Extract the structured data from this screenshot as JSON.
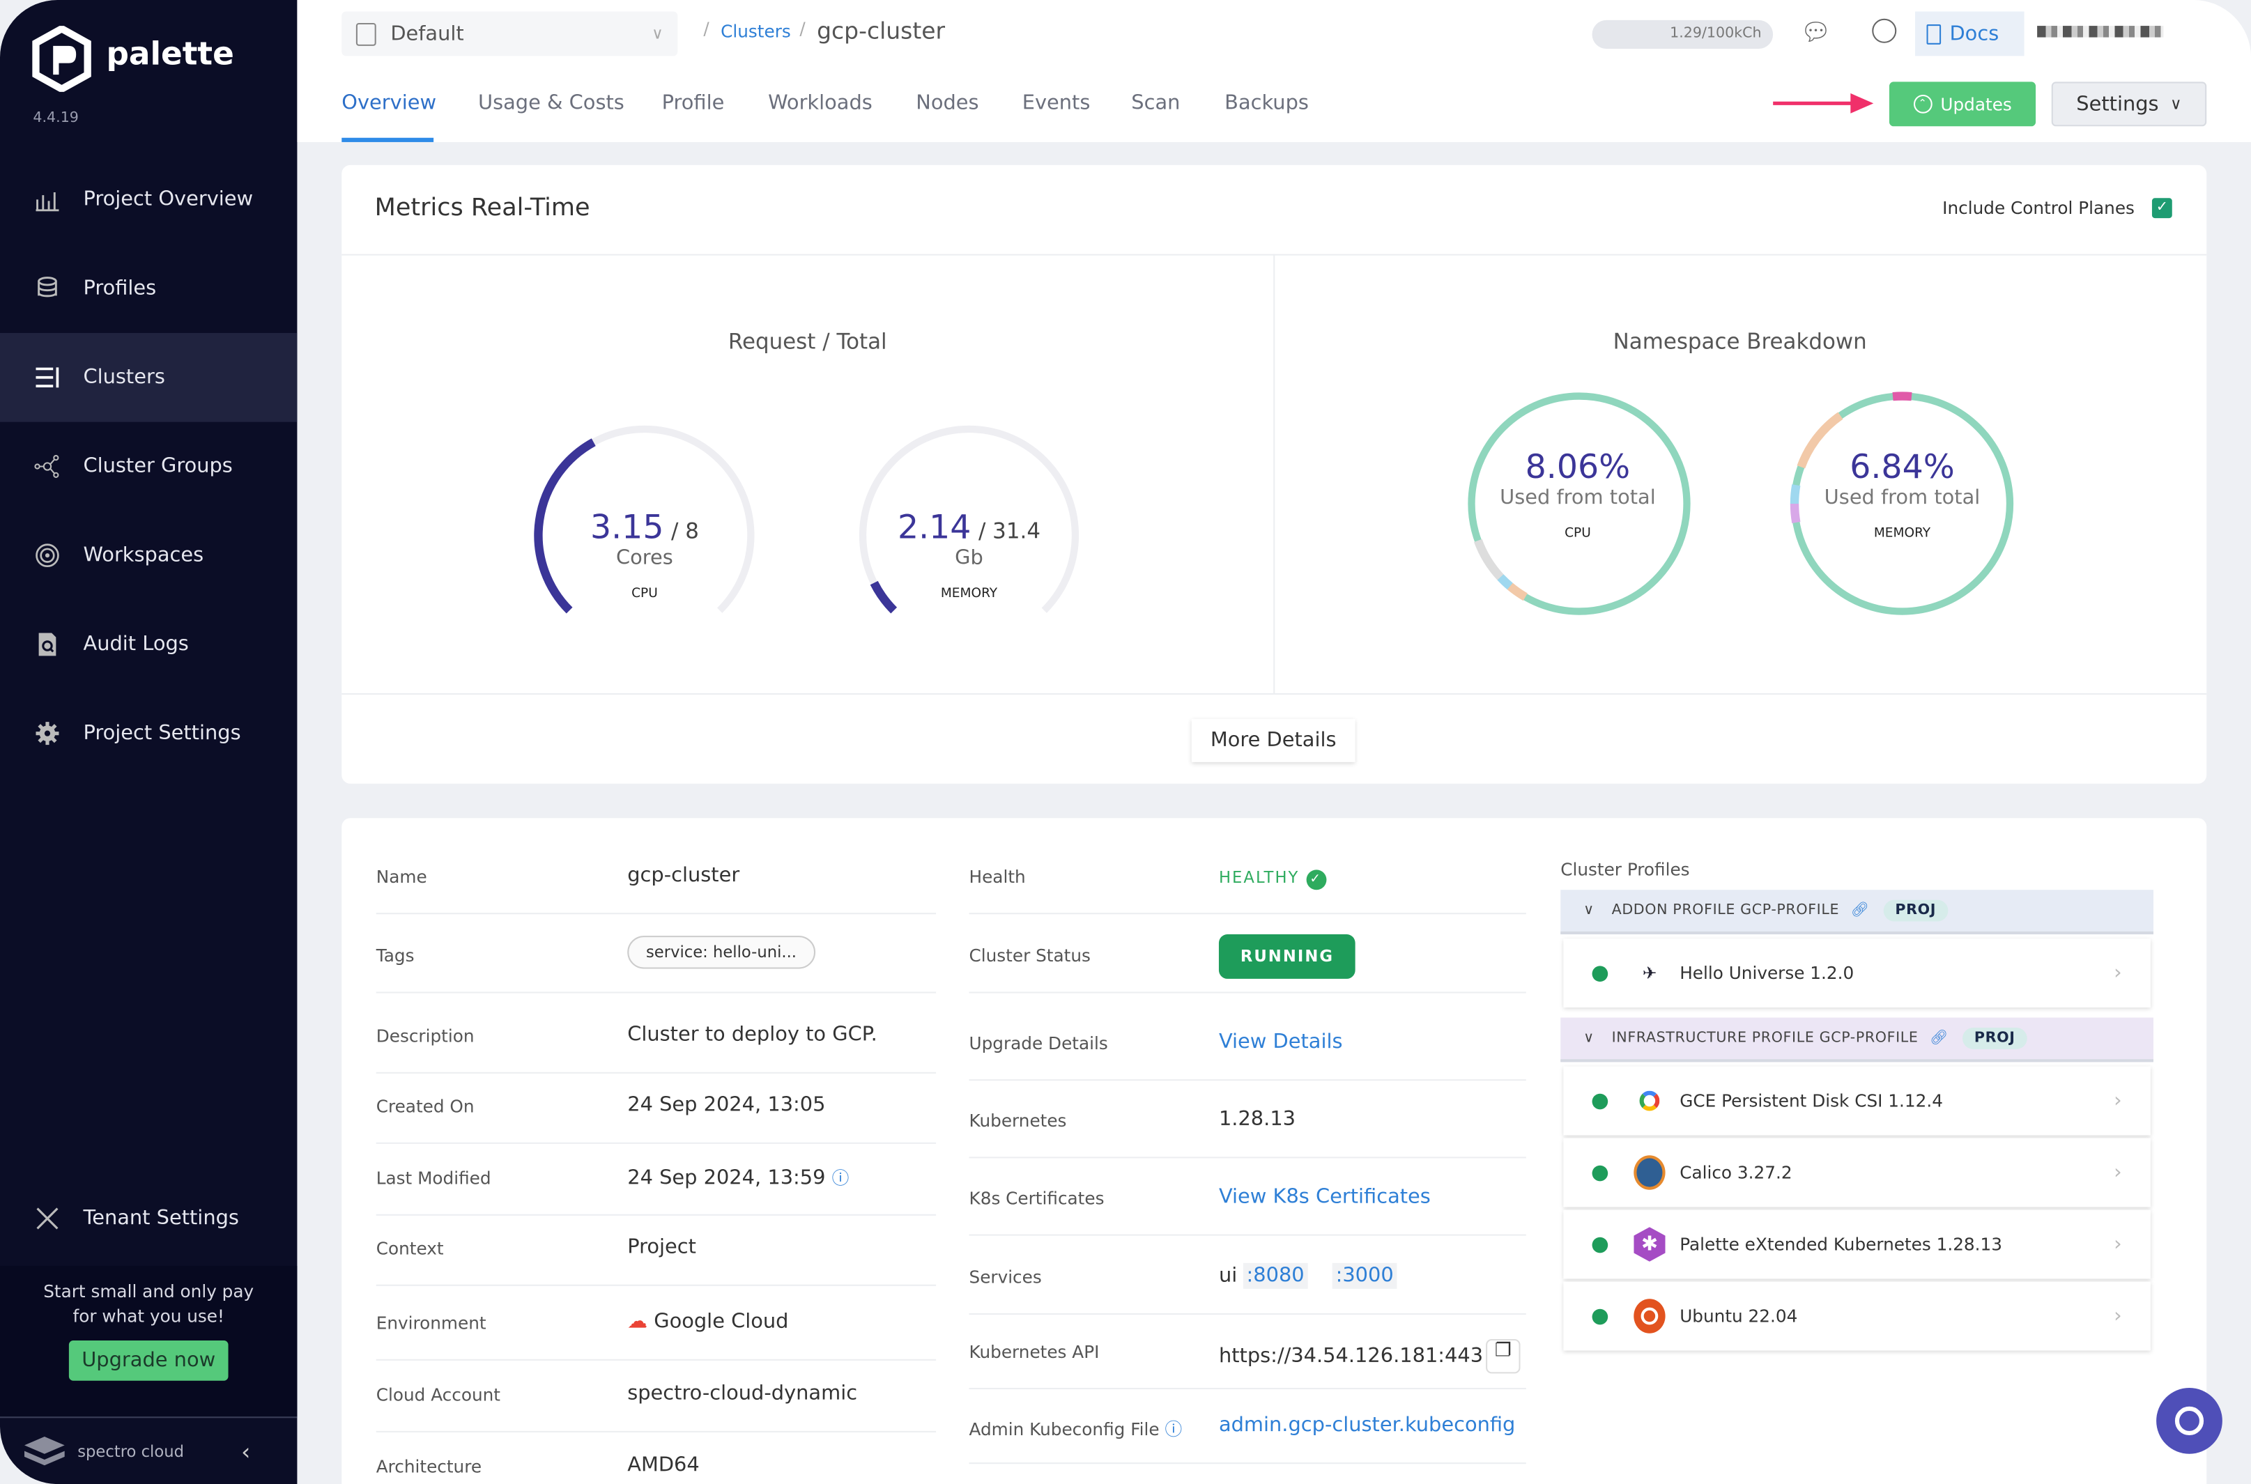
{
  "app": {
    "name": "palette",
    "version": "4.4.19"
  },
  "sidebar": {
    "items": [
      {
        "label": "Project Overview",
        "icon": "chart-icon"
      },
      {
        "label": "Profiles",
        "icon": "layers-icon"
      },
      {
        "label": "Clusters",
        "icon": "clusters-icon",
        "active": true
      },
      {
        "label": "Cluster Groups",
        "icon": "network-icon"
      },
      {
        "label": "Workspaces",
        "icon": "target-icon"
      },
      {
        "label": "Audit Logs",
        "icon": "audit-icon"
      },
      {
        "label": "Project Settings",
        "icon": "gear-icon"
      }
    ],
    "tenant_settings": "Tenant Settings",
    "promo_line1": "Start small and only pay",
    "promo_line2": "for what you use!",
    "upgrade": "Upgrade now",
    "brand": "spectro cloud"
  },
  "header": {
    "project": "Default",
    "breadcrumb": {
      "parent": "Clusters",
      "current": "gcp-cluster"
    },
    "usage": "1.29/100kCh",
    "docs": "Docs",
    "tabs": [
      "Overview",
      "Usage & Costs",
      "Profile",
      "Workloads",
      "Nodes",
      "Events",
      "Scan",
      "Backups"
    ],
    "active_tab": "Overview",
    "updates": "Updates",
    "settings": "Settings"
  },
  "metrics": {
    "title": "Metrics Real-Time",
    "include_control_planes": "Include Control Planes",
    "include_checked": true,
    "request_total": {
      "title": "Request / Total",
      "cpu": {
        "used": "3.15",
        "total": "/ 8",
        "unit": "Cores",
        "label": "CPU",
        "value": 3.15,
        "max": 8
      },
      "memory": {
        "used": "2.14",
        "total": "/ 31.4",
        "unit": "Gb",
        "label": "MEMORY",
        "value": 2.14,
        "max": 31.4
      }
    },
    "namespace": {
      "title": "Namespace Breakdown",
      "cpu": {
        "percent": "8.06%",
        "sub": "Used from total",
        "label": "CPU"
      },
      "memory": {
        "percent": "6.84%",
        "sub": "Used from total",
        "label": "MEMORY"
      }
    },
    "more": "More Details",
    "colors": {
      "gauge": "#3b3598",
      "track": "#eeeef2",
      "donut": "#8fd6bd"
    }
  },
  "details": {
    "left": [
      {
        "label": "Name",
        "value": "gcp-cluster"
      },
      {
        "label": "Tags",
        "value": "service: hello-uni..."
      },
      {
        "label": "Description",
        "value": "Cluster to deploy to GCP."
      },
      {
        "label": "Created On",
        "value": "24 Sep 2024, 13:05"
      },
      {
        "label": "Last Modified",
        "value": "24 Sep 2024, 13:59"
      },
      {
        "label": "Context",
        "value": "Project"
      },
      {
        "label": "Environment",
        "value": "Google Cloud"
      },
      {
        "label": "Cloud Account",
        "value": "spectro-cloud-dynamic"
      },
      {
        "label": "Architecture",
        "value": "AMD64"
      }
    ],
    "middle": [
      {
        "label": "Health",
        "value": "HEALTHY"
      },
      {
        "label": "Cluster Status",
        "value": "RUNNING"
      },
      {
        "label": "Upgrade Details",
        "value": "View Details"
      },
      {
        "label": "Kubernetes",
        "value": "1.28.13"
      },
      {
        "label": "K8s Certificates",
        "value": "View K8s Certificates"
      },
      {
        "label": "Services",
        "value": "ui",
        "ports": [
          ":8080",
          ":3000"
        ]
      },
      {
        "label": "Kubernetes API",
        "value": "https://34.54.126.181:443"
      },
      {
        "label": "Admin Kubeconfig File",
        "value": "admin.gcp-cluster.kubeconfig"
      }
    ]
  },
  "profiles": {
    "title": "Cluster Profiles",
    "groups": [
      {
        "name": "ADDON PROFILE GCP-PROFILE",
        "badge": "PROJ",
        "items": [
          "Hello Universe 1.2.0"
        ]
      },
      {
        "name": "INFRASTRUCTURE PROFILE GCP-PROFILE",
        "badge": "PROJ",
        "items": [
          "GCE Persistent Disk CSI 1.12.4",
          "Calico 3.27.2",
          "Palette eXtended Kubernetes 1.28.13",
          "Ubuntu 22.04"
        ]
      }
    ]
  }
}
